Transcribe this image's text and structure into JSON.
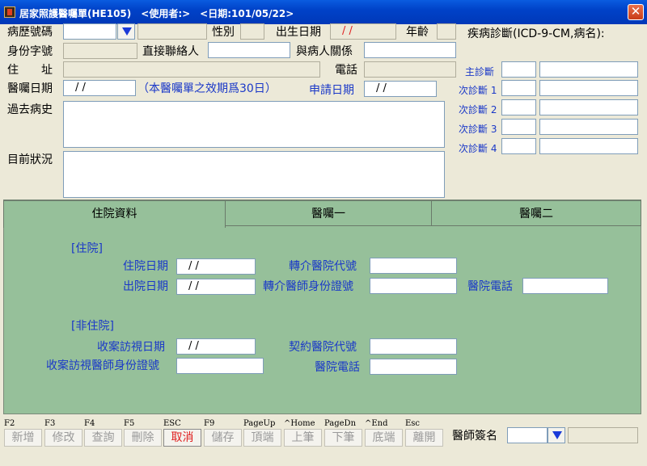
{
  "window": {
    "title": "居家照護醫囑單(HE105)　<使用者:>　<日期:101/05/22>",
    "close": "✕"
  },
  "top": {
    "record_no_label": "病歷號碼",
    "gender_label": "性別",
    "birth_label": "出生日期",
    "birth_value": "/ /",
    "age_label": "年齡",
    "diagnosis_label": "疾病診斷(ICD-9-CM,病名):",
    "id_label": "身份字號",
    "contact_label": "直接聯絡人",
    "relation_label": "與病人關係",
    "address_label": "住　　址",
    "phone_label": "電話",
    "order_date_label": "醫囑日期",
    "order_date_value": "/ /",
    "validity_note": "（本醫囑單之效期爲30日）",
    "apply_date_label": "申請日期",
    "apply_date_value": "/ /",
    "history_label": "過去病史",
    "status_label": "目前狀況"
  },
  "diagnoses": [
    {
      "label": "主診斷"
    },
    {
      "label": "次診斷 1"
    },
    {
      "label": "次診斷 2"
    },
    {
      "label": "次診斷 3"
    },
    {
      "label": "次診斷 4"
    }
  ],
  "tabs": [
    {
      "label": "住院資料",
      "active": true
    },
    {
      "label": "醫囑一",
      "active": false
    },
    {
      "label": "醫囑二",
      "active": false
    }
  ],
  "inpatient": {
    "section": "[住院]",
    "admit_date_label": "住院日期",
    "admit_date_value": "/ /",
    "discharge_date_label": "出院日期",
    "discharge_date_value": "/ /",
    "referral_hospital_label": "轉介醫院代號",
    "referral_doctor_label": "轉介醫師身份證號",
    "hospital_phone_label": "醫院電話"
  },
  "outpatient": {
    "section": "[非住院]",
    "visit_date_label": "收案訪視日期",
    "visit_date_value": "/ /",
    "visit_doctor_label": "收案訪視醫師身份證號",
    "contract_hospital_label": "契約醫院代號",
    "hospital_phone_label": "醫院電話"
  },
  "toolbar": [
    {
      "key": "F2",
      "label": "新增",
      "enabled": false
    },
    {
      "key": "F3",
      "label": "修改",
      "enabled": false
    },
    {
      "key": "F4",
      "label": "查詢",
      "enabled": false
    },
    {
      "key": "F5",
      "label": "刪除",
      "enabled": false
    },
    {
      "key": "ESC",
      "label": "取消",
      "enabled": true
    },
    {
      "key": "F9",
      "label": "儲存",
      "enabled": false
    },
    {
      "key": "PageUp",
      "label": "頂端",
      "enabled": false
    },
    {
      "key": "^Home",
      "label": "上筆",
      "enabled": false
    },
    {
      "key": "PageDn",
      "label": "下筆",
      "enabled": false
    },
    {
      "key": "^End",
      "label": "底端",
      "enabled": false
    },
    {
      "key": "Esc",
      "label": "離開",
      "enabled": false
    }
  ],
  "doctor_sign_label": "醫師簽名",
  "colors": {
    "titlebar": "#0042c8",
    "panel": "#96c09a",
    "label_blue": "#1a38c8",
    "active_red": "#e02020"
  }
}
